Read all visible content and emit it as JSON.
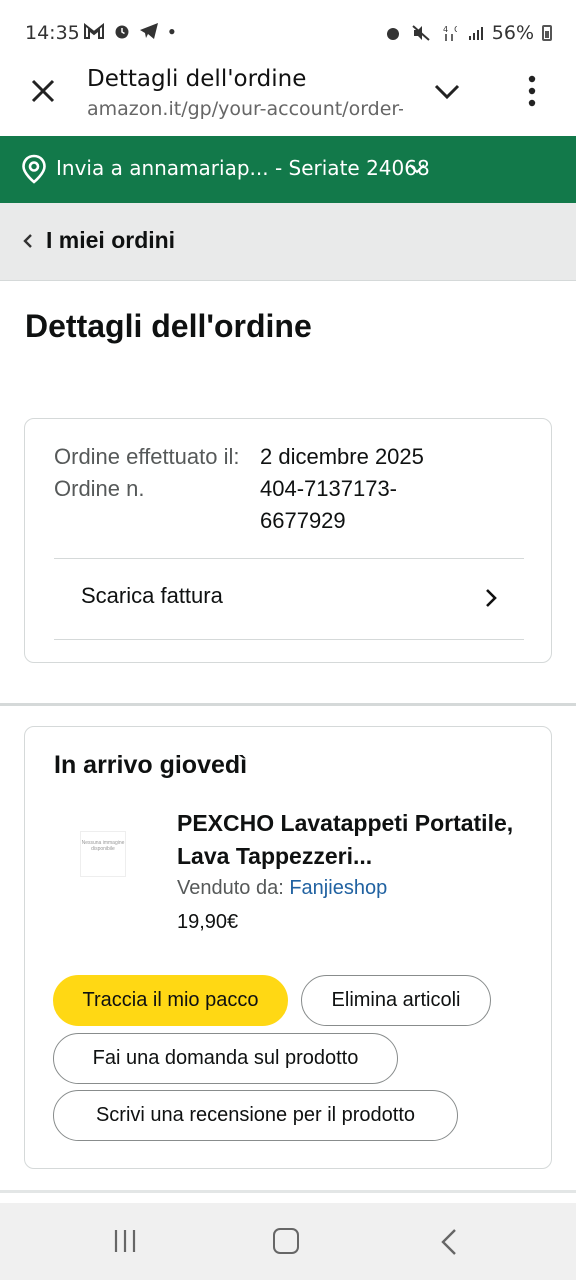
{
  "status_bar": {
    "time": "14:35",
    "battery": "56%"
  },
  "tab": {
    "title": "Dettagli dell'ordine",
    "url": "amazon.it/gp/your-account/order-d"
  },
  "delivery": {
    "text": "Invia a annamariap... - Seriate 24068"
  },
  "breadcrumb": {
    "label": "I miei ordini"
  },
  "page_title": "Dettagli dell'ordine",
  "order": {
    "placed_label": "Ordine effettuato il:",
    "number_label": "Ordine n.",
    "placed_date": "2 dicembre 2025",
    "number": "404-7137173-6677929",
    "invoice_label": "Scarica fattura"
  },
  "shipment": {
    "heading": "In arrivo giovedì",
    "image_placeholder": "Nessuna immagine disponibile",
    "product_name": "PEXCHO Lavatappeti Portatile, Lava Tappezzeri...",
    "seller_prefix": "Venduto da:",
    "seller_name": "Fanjieshop",
    "price": "19,90€",
    "buttons": {
      "track": "Traccia il mio pacco",
      "remove": "Elimina articoli",
      "ask": "Fai una domanda sul prodotto",
      "review": "Scrivi una recensione per il prodotto"
    }
  },
  "colors": {
    "delivery_bar": "#12794a",
    "primary_button": "#ffd814",
    "link": "#2162a1"
  }
}
